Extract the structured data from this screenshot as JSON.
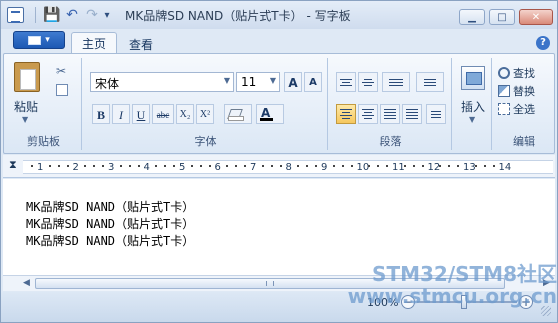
{
  "window": {
    "title": "MK品牌SD NAND（贴片式T卡） - 写字板"
  },
  "quick_access": {
    "save_icon": "floppy-disk",
    "undo_icon": "undo-arrow",
    "redo_icon": "redo-arrow"
  },
  "tabs": [
    {
      "label": "主页",
      "active": true
    },
    {
      "label": "查看",
      "active": false
    }
  ],
  "ribbon": {
    "clipboard": {
      "paste_label": "粘贴",
      "group_label": "剪贴板"
    },
    "font": {
      "font_name": "宋体",
      "font_size": "11",
      "grow_label": "A",
      "shrink_label": "A",
      "bold_label": "B",
      "italic_label": "I",
      "underline_label": "U",
      "strike_label": "abc",
      "subscript_label": "X₂",
      "superscript_label": "X²",
      "font_color_label": "A",
      "group_label": "字体"
    },
    "paragraph": {
      "group_label": "段落"
    },
    "insert": {
      "insert_label": "插入"
    },
    "editing": {
      "find_label": "查找",
      "replace_label": "替换",
      "select_all_label": "全选",
      "group_label": "编辑"
    }
  },
  "ruler": {
    "ticks": [
      "1",
      "2",
      "3",
      "4",
      "5",
      "6",
      "7",
      "8",
      "9",
      "10",
      "11",
      "12",
      "13",
      "14"
    ]
  },
  "document": {
    "lines": [
      "MK品牌SD NAND（贴片式T卡）",
      "MK品牌SD NAND（贴片式T卡）",
      "MK品牌SD NAND（贴片式T卡）"
    ]
  },
  "status": {
    "zoom": "100%"
  },
  "watermark": {
    "line1": "STM32/STM8社区",
    "line2": "www.stmcu.org.cn"
  },
  "colors": {
    "accent": "#1c58b3",
    "ribbon_bg": "#dbe7f5",
    "active_align": "#f6c75e"
  }
}
